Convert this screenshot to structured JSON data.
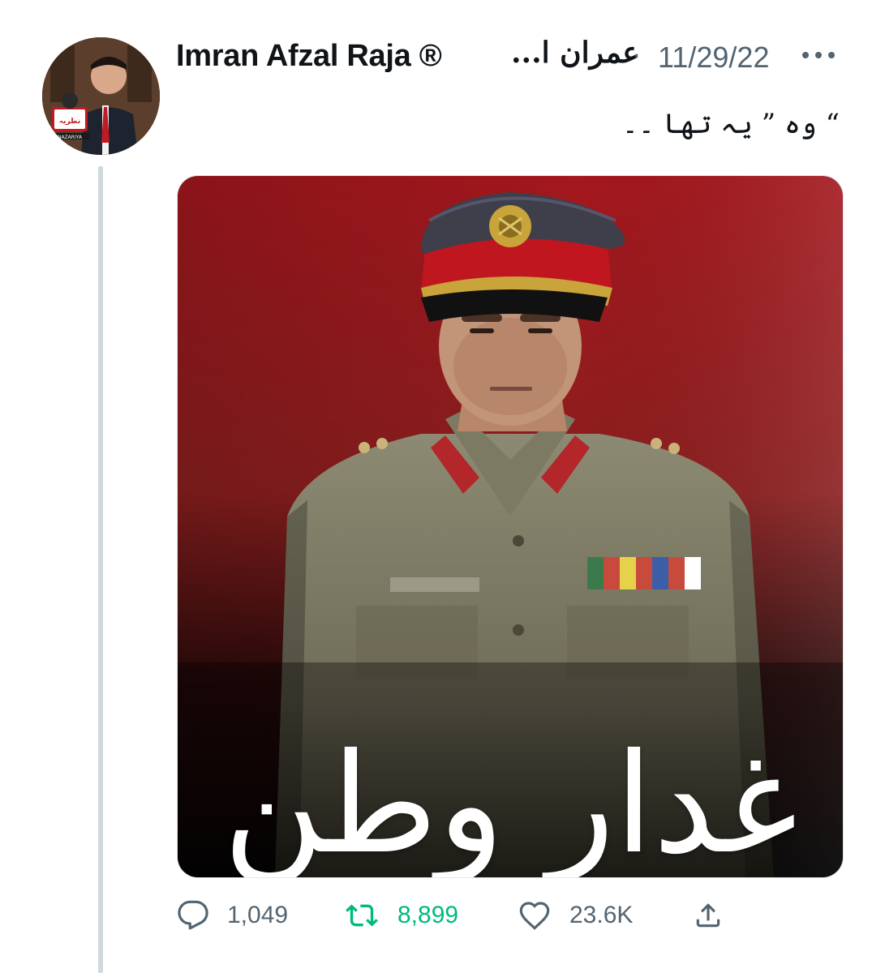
{
  "author": {
    "display_name": "Imran Afzal Raja ®",
    "name_suffix": "عمران ا...",
    "separator": "·",
    "date": "11/29/22",
    "avatar_logo_text": "NAZARIYA"
  },
  "tweet": {
    "text": "“ وہ ” یہ تھا ۔۔",
    "image_overlay_text": "غدارِ وطن"
  },
  "actions": {
    "reply_count": "1,049",
    "retweet_count": "8,899",
    "like_count": "23.6K"
  },
  "icons": {
    "more": "more-icon",
    "reply": "reply-icon",
    "retweet": "retweet-icon",
    "like": "heart-icon",
    "share": "share-icon"
  },
  "colors": {
    "text_primary": "#0f1419",
    "text_secondary": "#536471",
    "retweet_active": "#00ba7c",
    "thread_line": "#cfd9de",
    "image_background_top": "#a3171d"
  }
}
